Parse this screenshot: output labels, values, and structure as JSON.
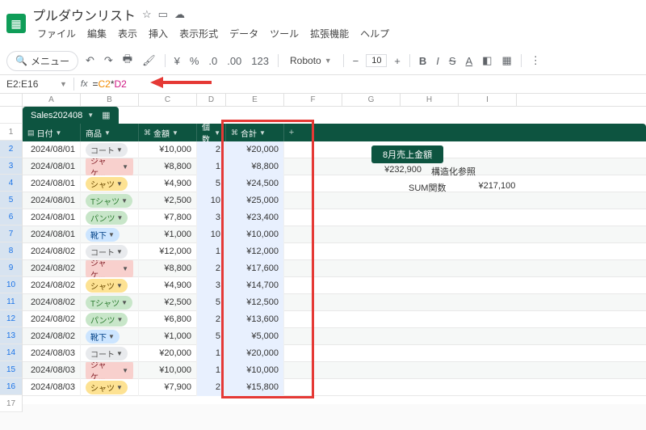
{
  "doc": {
    "title": "プルダウンリスト"
  },
  "menu": {
    "items": [
      "ファイル",
      "編集",
      "表示",
      "挿入",
      "表示形式",
      "データ",
      "ツール",
      "拡張機能",
      "ヘルプ"
    ]
  },
  "toolbar": {
    "menu_label": "メニュー",
    "font": "Roboto",
    "font_size": "10"
  },
  "range": "E2:E16",
  "formula": {
    "p1": "=",
    "p2": "C2",
    "p3": "*",
    "p4": "D2"
  },
  "cols": [
    "A",
    "B",
    "C",
    "D",
    "E",
    "F",
    "G",
    "H",
    "I"
  ],
  "tablename": "Sales202408",
  "headers": {
    "date": "日付",
    "product": "商品",
    "amount": "金額",
    "qty": "個数",
    "total": "合計"
  },
  "rows": [
    {
      "n": "2",
      "d": "2024/08/01",
      "p": "コート",
      "cls": "c1",
      "a": "¥10,000",
      "q": "2",
      "t": "¥20,000"
    },
    {
      "n": "3",
      "d": "2024/08/01",
      "p": "ジャケ...",
      "cls": "c2",
      "a": "¥8,800",
      "q": "1",
      "t": "¥8,800"
    },
    {
      "n": "4",
      "d": "2024/08/01",
      "p": "シャツ",
      "cls": "c3",
      "a": "¥4,900",
      "q": "5",
      "t": "¥24,500"
    },
    {
      "n": "5",
      "d": "2024/08/01",
      "p": "Tシャツ",
      "cls": "c4",
      "a": "¥2,500",
      "q": "10",
      "t": "¥25,000"
    },
    {
      "n": "6",
      "d": "2024/08/01",
      "p": "パンツ",
      "cls": "c4",
      "a": "¥7,800",
      "q": "3",
      "t": "¥23,400"
    },
    {
      "n": "7",
      "d": "2024/08/01",
      "p": "靴下",
      "cls": "c5",
      "a": "¥1,000",
      "q": "10",
      "t": "¥10,000"
    },
    {
      "n": "8",
      "d": "2024/08/02",
      "p": "コート",
      "cls": "c1",
      "a": "¥12,000",
      "q": "1",
      "t": "¥12,000"
    },
    {
      "n": "9",
      "d": "2024/08/02",
      "p": "ジャケ...",
      "cls": "c2",
      "a": "¥8,800",
      "q": "2",
      "t": "¥17,600"
    },
    {
      "n": "10",
      "d": "2024/08/02",
      "p": "シャツ",
      "cls": "c3",
      "a": "¥4,900",
      "q": "3",
      "t": "¥14,700"
    },
    {
      "n": "11",
      "d": "2024/08/02",
      "p": "Tシャツ",
      "cls": "c4",
      "a": "¥2,500",
      "q": "5",
      "t": "¥12,500"
    },
    {
      "n": "12",
      "d": "2024/08/02",
      "p": "パンツ",
      "cls": "c4",
      "a": "¥6,800",
      "q": "2",
      "t": "¥13,600"
    },
    {
      "n": "13",
      "d": "2024/08/02",
      "p": "靴下",
      "cls": "c5",
      "a": "¥1,000",
      "q": "5",
      "t": "¥5,000"
    },
    {
      "n": "14",
      "d": "2024/08/03",
      "p": "コート",
      "cls": "c1",
      "a": "¥20,000",
      "q": "1",
      "t": "¥20,000"
    },
    {
      "n": "15",
      "d": "2024/08/03",
      "p": "ジャケ...",
      "cls": "c2",
      "a": "¥10,000",
      "q": "1",
      "t": "¥10,000"
    },
    {
      "n": "16",
      "d": "2024/08/03",
      "p": "シャツ",
      "cls": "c3",
      "a": "¥7,900",
      "q": "2",
      "t": "¥15,800"
    }
  ],
  "side": {
    "title": "8月売上金額",
    "struct_val": "¥232,900",
    "struct_lbl": "構造化参照",
    "sum_lbl": "SUM関数",
    "sum_val": "¥217,100"
  },
  "row1": "1",
  "row17": "17"
}
